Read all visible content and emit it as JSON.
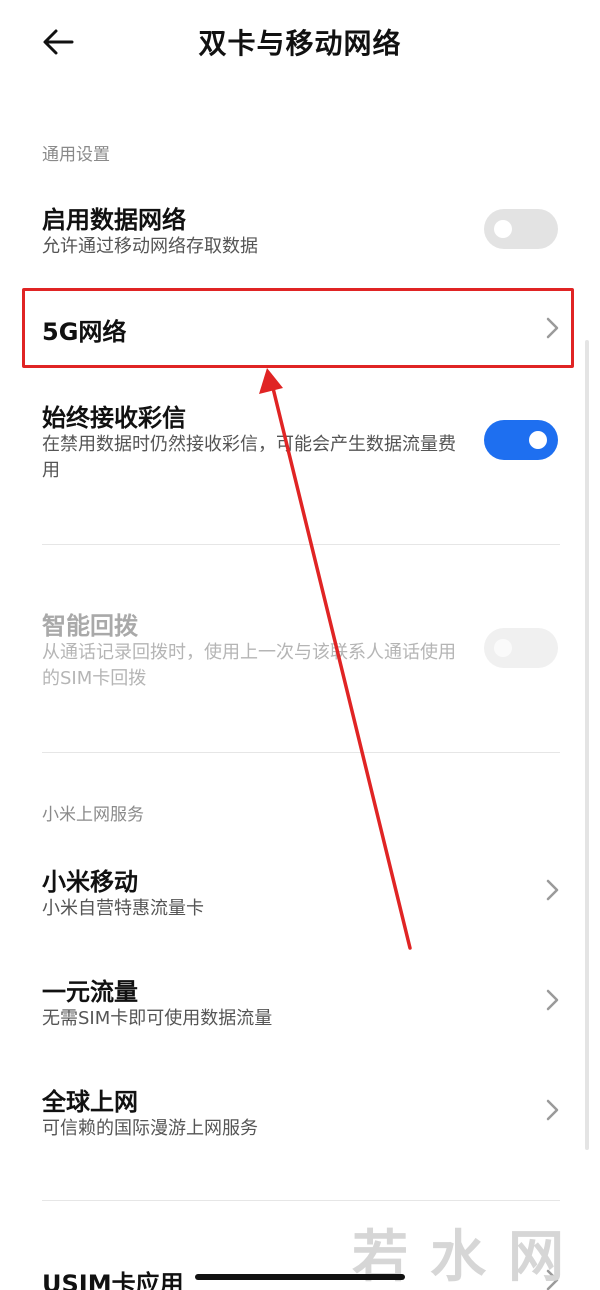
{
  "header": {
    "back_icon": "arrow-left-icon",
    "title": "双卡与移动网络"
  },
  "general": {
    "label": "通用设置",
    "data_network": {
      "title": "启用数据网络",
      "desc": "允许通过移动网络存取数据",
      "enabled": false
    },
    "network_5g": {
      "title": "5G网络",
      "icon": "chevron-right-icon"
    },
    "always_mms": {
      "title": "始终接收彩信",
      "desc": "在禁用数据时仍然接收彩信，可能会产生数据流量费用",
      "enabled": true
    },
    "smart_redial": {
      "title": "智能回拨",
      "desc": "从通话记录回拨时，使用上一次与该联系人通话使用的SIM卡回拨",
      "enabled": false,
      "disabled": true
    }
  },
  "xiaomi_services": {
    "label": "小米上网服务",
    "items": [
      {
        "title": "小米移动",
        "desc": "小米自营特惠流量卡"
      },
      {
        "title": "一元流量",
        "desc": "无需SIM卡即可使用数据流量"
      },
      {
        "title": "全球上网",
        "desc": "可信赖的国际漫游上网服务"
      }
    ]
  },
  "usim": {
    "title": "USIM卡应用"
  },
  "annotation": {
    "color": "#e02424"
  },
  "colors": {
    "toggle_on": "#1e6ff0",
    "toggle_off": "#e3e3e3"
  },
  "watermark": "若水网"
}
